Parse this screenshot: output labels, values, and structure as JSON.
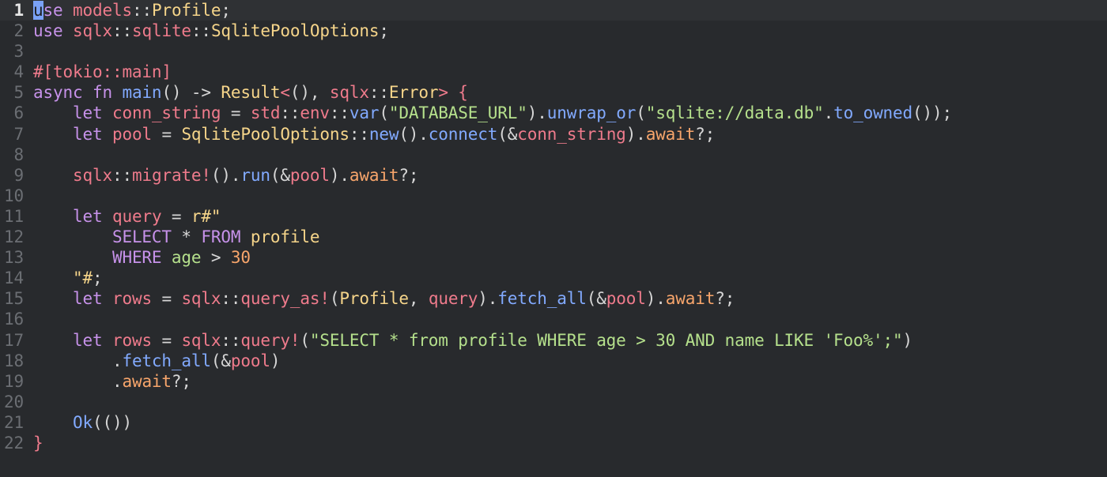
{
  "editor": {
    "cursor": {
      "line": 1,
      "column": 1
    },
    "lines": [
      {
        "number": "1",
        "tokens": [
          {
            "t": "u",
            "c": "cursor-char"
          },
          {
            "t": "se ",
            "c": "t-kw"
          },
          {
            "t": "models",
            "c": "t-ns"
          },
          {
            "t": "::",
            "c": "t-p"
          },
          {
            "t": "Profile",
            "c": "t-type"
          },
          {
            "t": ";",
            "c": "t-p"
          }
        ]
      },
      {
        "number": "2",
        "tokens": [
          {
            "t": "use ",
            "c": "t-kw"
          },
          {
            "t": "sqlx",
            "c": "t-ns"
          },
          {
            "t": "::",
            "c": "t-p"
          },
          {
            "t": "sqlite",
            "c": "t-ns"
          },
          {
            "t": "::",
            "c": "t-p"
          },
          {
            "t": "SqlitePoolOptions",
            "c": "t-type"
          },
          {
            "t": ";",
            "c": "t-p"
          }
        ]
      },
      {
        "number": "3",
        "tokens": []
      },
      {
        "number": "4",
        "tokens": [
          {
            "t": "#[tokio::main]",
            "c": "t-attr"
          }
        ]
      },
      {
        "number": "5",
        "tokens": [
          {
            "t": "async fn ",
            "c": "t-kw"
          },
          {
            "t": "main",
            "c": "t-fn"
          },
          {
            "t": "() -> ",
            "c": "t-p"
          },
          {
            "t": "Result",
            "c": "t-type"
          },
          {
            "t": "<",
            "c": "t-ns"
          },
          {
            "t": "(), ",
            "c": "t-p"
          },
          {
            "t": "sqlx",
            "c": "t-ns"
          },
          {
            "t": "::",
            "c": "t-p"
          },
          {
            "t": "Error",
            "c": "t-type"
          },
          {
            "t": "> {",
            "c": "t-ns"
          }
        ]
      },
      {
        "number": "6",
        "tokens": [
          {
            "t": "    ",
            "c": "t-p"
          },
          {
            "t": "let ",
            "c": "t-kw"
          },
          {
            "t": "conn_string",
            "c": "t-ns"
          },
          {
            "t": " = ",
            "c": "t-p"
          },
          {
            "t": "std",
            "c": "t-ns"
          },
          {
            "t": "::",
            "c": "t-p"
          },
          {
            "t": "env",
            "c": "t-ns"
          },
          {
            "t": "::",
            "c": "t-p"
          },
          {
            "t": "var",
            "c": "t-fn"
          },
          {
            "t": "(",
            "c": "t-p"
          },
          {
            "t": "\"DATABASE_URL\"",
            "c": "t-str"
          },
          {
            "t": ").",
            "c": "t-p"
          },
          {
            "t": "unwrap_or",
            "c": "t-fn"
          },
          {
            "t": "(",
            "c": "t-p"
          },
          {
            "t": "\"sqlite://data.db\"",
            "c": "t-str"
          },
          {
            "t": ".",
            "c": "t-p"
          },
          {
            "t": "to_owned",
            "c": "t-fn"
          },
          {
            "t": "());",
            "c": "t-p"
          }
        ]
      },
      {
        "number": "7",
        "tokens": [
          {
            "t": "    ",
            "c": "t-p"
          },
          {
            "t": "let ",
            "c": "t-kw"
          },
          {
            "t": "pool",
            "c": "t-ns"
          },
          {
            "t": " = ",
            "c": "t-p"
          },
          {
            "t": "SqlitePoolOptions",
            "c": "t-type"
          },
          {
            "t": "::",
            "c": "t-p"
          },
          {
            "t": "new",
            "c": "t-fn"
          },
          {
            "t": "().",
            "c": "t-p"
          },
          {
            "t": "connect",
            "c": "t-fn"
          },
          {
            "t": "(&",
            "c": "t-p"
          },
          {
            "t": "conn_string",
            "c": "t-ns"
          },
          {
            "t": ").",
            "c": "t-p"
          },
          {
            "t": "await",
            "c": "t-num"
          },
          {
            "t": "?;",
            "c": "t-p"
          }
        ]
      },
      {
        "number": "8",
        "tokens": []
      },
      {
        "number": "9",
        "tokens": [
          {
            "t": "    ",
            "c": "t-p"
          },
          {
            "t": "sqlx",
            "c": "t-ns"
          },
          {
            "t": "::",
            "c": "t-p"
          },
          {
            "t": "migrate!",
            "c": "t-ns"
          },
          {
            "t": "().",
            "c": "t-p"
          },
          {
            "t": "run",
            "c": "t-fn"
          },
          {
            "t": "(&",
            "c": "t-p"
          },
          {
            "t": "pool",
            "c": "t-ns"
          },
          {
            "t": ").",
            "c": "t-p"
          },
          {
            "t": "await",
            "c": "t-num"
          },
          {
            "t": "?;",
            "c": "t-p"
          }
        ]
      },
      {
        "number": "10",
        "tokens": []
      },
      {
        "number": "11",
        "tokens": [
          {
            "t": "    ",
            "c": "t-p"
          },
          {
            "t": "let ",
            "c": "t-kw"
          },
          {
            "t": "query",
            "c": "t-ns"
          },
          {
            "t": " = ",
            "c": "t-p"
          },
          {
            "t": "r#\"",
            "c": "t-type"
          }
        ]
      },
      {
        "number": "12",
        "tokens": [
          {
            "t": "        ",
            "c": "t-p"
          },
          {
            "t": "SELECT",
            "c": "t-kw"
          },
          {
            "t": " * ",
            "c": "t-p"
          },
          {
            "t": "FROM",
            "c": "t-kw"
          },
          {
            "t": " profile",
            "c": "t-type"
          }
        ]
      },
      {
        "number": "13",
        "tokens": [
          {
            "t": "        ",
            "c": "t-p"
          },
          {
            "t": "WHERE",
            "c": "t-kw"
          },
          {
            "t": " age ",
            "c": "t-str"
          },
          {
            "t": "> ",
            "c": "t-p"
          },
          {
            "t": "30",
            "c": "t-num"
          }
        ]
      },
      {
        "number": "14",
        "tokens": [
          {
            "t": "    ",
            "c": "t-p"
          },
          {
            "t": "\"#",
            "c": "t-type"
          },
          {
            "t": ";",
            "c": "t-p"
          }
        ]
      },
      {
        "number": "15",
        "tokens": [
          {
            "t": "    ",
            "c": "t-p"
          },
          {
            "t": "let ",
            "c": "t-kw"
          },
          {
            "t": "rows",
            "c": "t-ns"
          },
          {
            "t": " = ",
            "c": "t-p"
          },
          {
            "t": "sqlx",
            "c": "t-ns"
          },
          {
            "t": "::",
            "c": "t-p"
          },
          {
            "t": "query_as!",
            "c": "t-ns"
          },
          {
            "t": "(",
            "c": "t-p"
          },
          {
            "t": "Profile",
            "c": "t-type"
          },
          {
            "t": ", ",
            "c": "t-p"
          },
          {
            "t": "query",
            "c": "t-ns"
          },
          {
            "t": ").",
            "c": "t-p"
          },
          {
            "t": "fetch_all",
            "c": "t-fn"
          },
          {
            "t": "(&",
            "c": "t-p"
          },
          {
            "t": "pool",
            "c": "t-ns"
          },
          {
            "t": ").",
            "c": "t-p"
          },
          {
            "t": "await",
            "c": "t-num"
          },
          {
            "t": "?;",
            "c": "t-p"
          }
        ]
      },
      {
        "number": "16",
        "tokens": []
      },
      {
        "number": "17",
        "tokens": [
          {
            "t": "    ",
            "c": "t-p"
          },
          {
            "t": "let ",
            "c": "t-kw"
          },
          {
            "t": "rows",
            "c": "t-ns"
          },
          {
            "t": " = ",
            "c": "t-p"
          },
          {
            "t": "sqlx",
            "c": "t-ns"
          },
          {
            "t": "::",
            "c": "t-p"
          },
          {
            "t": "query!",
            "c": "t-ns"
          },
          {
            "t": "(",
            "c": "t-p"
          },
          {
            "t": "\"SELECT * from profile WHERE age > 30 AND name LIKE 'Foo%';\"",
            "c": "t-str"
          },
          {
            "t": ")",
            "c": "t-p"
          }
        ]
      },
      {
        "number": "18",
        "tokens": [
          {
            "t": "        .",
            "c": "t-p"
          },
          {
            "t": "fetch_all",
            "c": "t-fn"
          },
          {
            "t": "(&",
            "c": "t-p"
          },
          {
            "t": "pool",
            "c": "t-ns"
          },
          {
            "t": ")",
            "c": "t-p"
          }
        ]
      },
      {
        "number": "19",
        "tokens": [
          {
            "t": "        .",
            "c": "t-p"
          },
          {
            "t": "await",
            "c": "t-num"
          },
          {
            "t": "?;",
            "c": "t-p"
          }
        ]
      },
      {
        "number": "20",
        "tokens": []
      },
      {
        "number": "21",
        "tokens": [
          {
            "t": "    ",
            "c": "t-p"
          },
          {
            "t": "Ok",
            "c": "t-fn"
          },
          {
            "t": "(())",
            "c": "t-p"
          }
        ]
      },
      {
        "number": "22",
        "tokens": [
          {
            "t": "}",
            "c": "t-ns"
          }
        ]
      }
    ],
    "colors": {
      "background": "#282a2d",
      "current_line": "#2f3134",
      "keyword": "#c792ea",
      "identifier": "#ef7b8c",
      "type": "#f6d58a",
      "function": "#82aaff",
      "string": "#b5e08c",
      "number": "#f7a56b",
      "gutter": "#6b6e73",
      "cursor": "#7aa2f7"
    }
  }
}
